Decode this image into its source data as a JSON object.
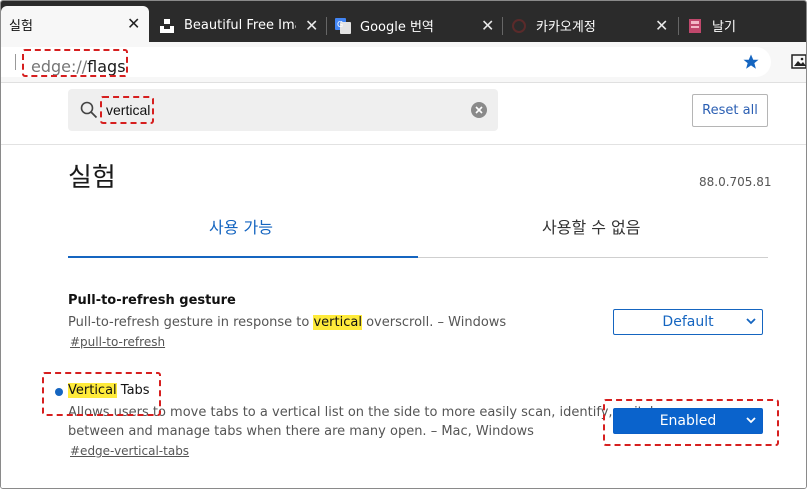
{
  "tabs": [
    {
      "title": "실험",
      "active": true
    },
    {
      "title": "Beautiful Free Image"
    },
    {
      "title": "Google 번역"
    },
    {
      "title": "카카오계정"
    },
    {
      "title": "날기"
    }
  ],
  "address": {
    "scheme": "edge://",
    "host": "flags"
  },
  "search": {
    "value": "vertical"
  },
  "reset_label": "Reset all",
  "page_title": "실험",
  "version": "88.0.705.81",
  "content_tabs": [
    "사용 가능",
    "사용할 수 없음"
  ],
  "experiments": [
    {
      "name": "Pull-to-refresh gesture",
      "desc_before": "Pull-to-refresh gesture in response to ",
      "desc_highlight": "vertical",
      "desc_after": " overscroll. – Windows",
      "link": "#pull-to-refresh",
      "select": "Default"
    },
    {
      "name_highlight": "Vertical",
      "name_rest": " Tabs",
      "desc_line1": "Allows users to move tabs to a vertical list on the side to more easily scan, identify, switch",
      "desc_line2": "between and manage tabs when there are many open. – Mac, Windows",
      "link": "#edge-vertical-tabs",
      "select": "Enabled"
    }
  ],
  "colors": {
    "accent": "#1565c0",
    "highlight": "#ffeb3b",
    "annotation": "#d61f1f",
    "tabbar": "#2b2b2b"
  },
  "icons": [
    "edge-tab-icon",
    "unsplash-icon",
    "google-translate-icon",
    "kakao-icon",
    "diary-icon",
    "star-icon",
    "image-icon",
    "search-icon",
    "clear-icon",
    "chevron-down-icon"
  ]
}
